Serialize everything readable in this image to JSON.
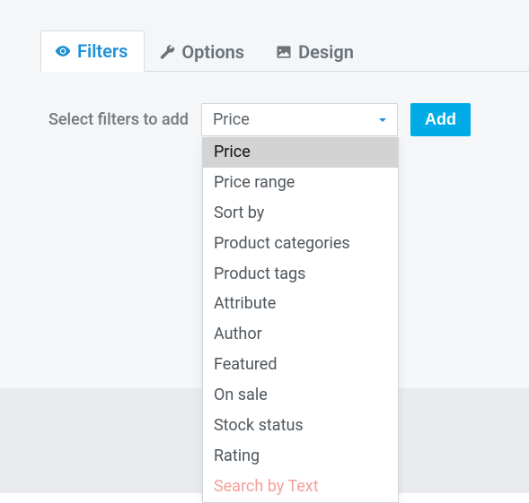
{
  "tabs": {
    "filters": "Filters",
    "options": "Options",
    "design": "Design"
  },
  "filter_area": {
    "label": "Select filters to add",
    "selected": "Price",
    "add_button": "Add",
    "options": [
      "Price",
      "Price range",
      "Sort by",
      "Product categories",
      "Product tags",
      "Attribute",
      "Author",
      "Featured",
      "On sale",
      "Stock status",
      "Rating",
      "Search by Text"
    ]
  },
  "colors": {
    "accent": "#1e90d6",
    "button": "#00abe8"
  }
}
